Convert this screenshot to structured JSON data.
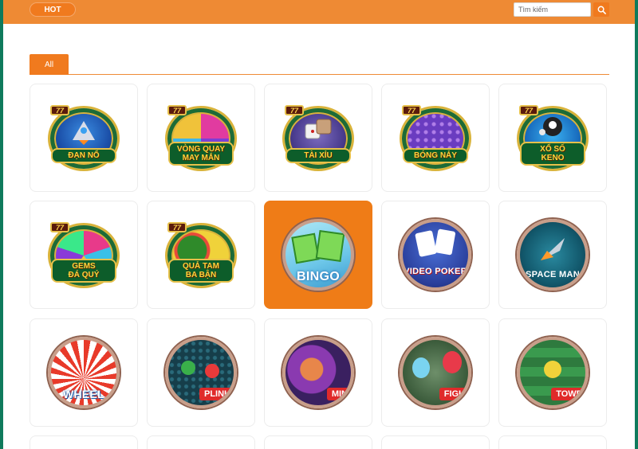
{
  "header": {
    "hot_label": "HOT",
    "search_placeholder": "Tìm kiếm"
  },
  "tabs": [
    {
      "label": "All"
    }
  ],
  "games": [
    {
      "name": "Đạn Nổ",
      "badge": "77",
      "lines": [
        "ĐẠN NỔ"
      ]
    },
    {
      "name": "Vòng Quay May Mắn",
      "badge": "77",
      "lines": [
        "VÒNG QUAY",
        "MAY MẮN"
      ]
    },
    {
      "name": "Tài Xỉu",
      "badge": "77",
      "lines": [
        "TÀI XỈU"
      ]
    },
    {
      "name": "Bóng Nảy",
      "badge": "77",
      "lines": [
        "BÓNG NẢY"
      ]
    },
    {
      "name": "Xổ Số Keno",
      "badge": "77",
      "lines": [
        "XỔ SỐ",
        "KENO"
      ]
    },
    {
      "name": "Gems Đá Quý",
      "badge": "77",
      "lines": [
        "GEMS",
        "ĐÁ QUÝ"
      ]
    },
    {
      "name": "Quả Tam Ba Bận",
      "badge": "77",
      "lines": [
        "QUẢ TAM",
        "BA BẬN"
      ]
    },
    {
      "name": "Bingo",
      "label": "BINGO",
      "sub": "BINGO"
    },
    {
      "name": "Video Poker",
      "label": "VIDEO POKER"
    },
    {
      "name": "Space Man",
      "label": "SPACE MAN"
    },
    {
      "name": "Wheel",
      "label": "WHEEL"
    },
    {
      "name": "Plinko",
      "label": "PLINK"
    },
    {
      "name": "Mines",
      "label": "MIN"
    },
    {
      "name": "Fight",
      "label": "FIGH"
    },
    {
      "name": "Tower",
      "label": "TOWE"
    }
  ],
  "colors": {
    "header": "#ee8a34",
    "accent": "#f07a1e",
    "active_card": "#ef7c17",
    "border_side": "#0f7a5c"
  },
  "icons": [
    "search-icon"
  ]
}
